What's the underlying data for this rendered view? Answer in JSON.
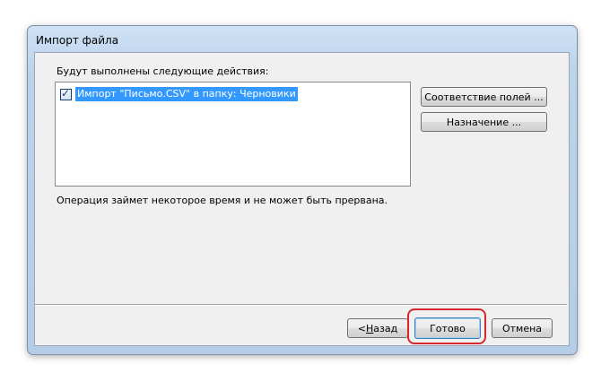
{
  "window": {
    "title": "Импорт файла"
  },
  "content": {
    "actions_label": "Будут выполнены следующие действия:",
    "actions": [
      {
        "label": "Импорт \"Письмо.CSV\" в папку: Черновики",
        "checked": true
      }
    ],
    "operation_note": "Операция займет некоторое время и не может быть прервана."
  },
  "side_buttons": {
    "map_fields": "Соответствие полей ...",
    "destination": "Назначение ..."
  },
  "footer": {
    "back_prefix": "< ",
    "back_underlined": "Н",
    "back_rest": "азад",
    "finish": "Готово",
    "cancel": "Отмена"
  },
  "colors": {
    "selection": "#3399ff",
    "highlight_ring": "#d7262e",
    "frame_bg": "#bcd3ec",
    "client_bg": "#f0f0f0"
  }
}
